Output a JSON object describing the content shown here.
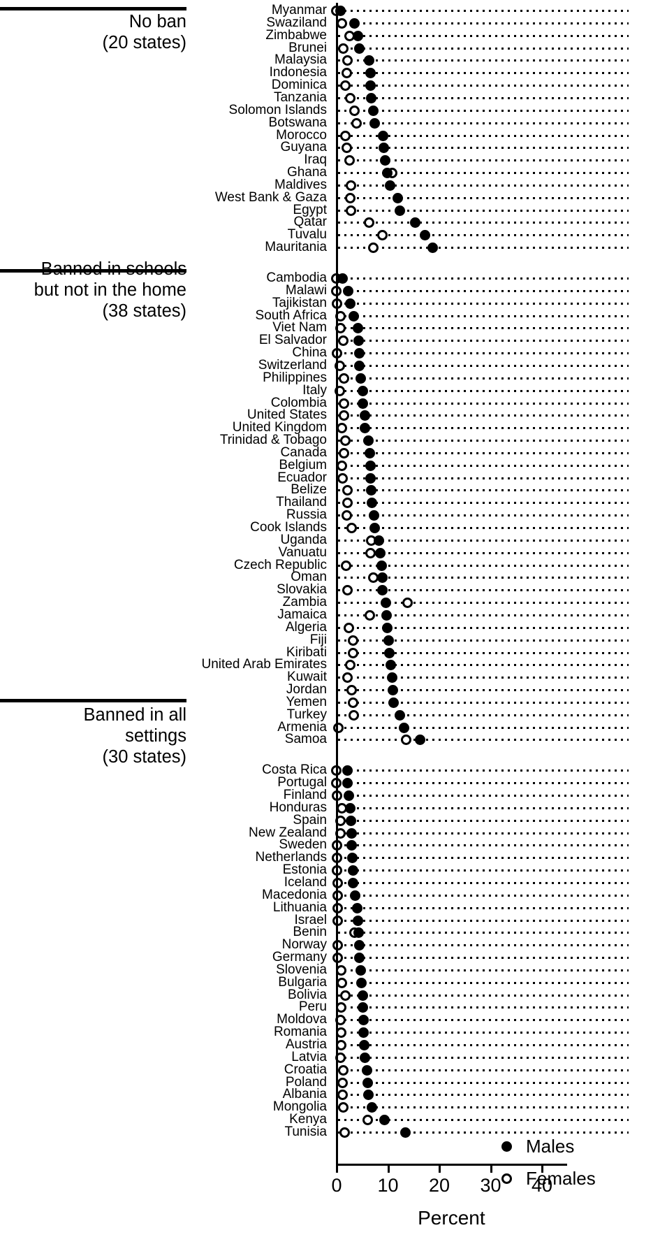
{
  "figure": {
    "xlabel": "Percent",
    "legend": [
      {
        "marker": "filled-circle",
        "label": "Males"
      },
      {
        "marker": "open-circle",
        "label": "Females"
      }
    ]
  },
  "chart_data": {
    "type": "scatter",
    "title": "",
    "xlabel": "Percent",
    "ylabel": "",
    "xlim": [
      0,
      45
    ],
    "xticks": [
      0,
      10,
      20,
      30,
      40
    ],
    "xticklabels": [
      "0",
      "10",
      "20",
      "30",
      "40"
    ],
    "grid": "dotted horizontal leader lines per row",
    "legend_position": "bottom-right",
    "series": [
      {
        "name": "Males",
        "marker": "filled-circle"
      },
      {
        "name": "Females",
        "marker": "open-circle"
      }
    ],
    "groups": [
      {
        "header": "No ban\n(20 states)",
        "header_line1": "No ban",
        "header_line2": "(20 states)",
        "states": 20,
        "rows": [
          {
            "label": "Myanmar",
            "males": 0.9,
            "females": 0.1
          },
          {
            "label": "Swaziland",
            "males": 3.6,
            "females": 1.2
          },
          {
            "label": "Zimbabwe",
            "males": 4.3,
            "females": 2.7
          },
          {
            "label": "Brunei",
            "males": 4.5,
            "females": 1.4
          },
          {
            "label": "Malaysia",
            "males": 6.5,
            "females": 2.3
          },
          {
            "label": "Indonesia",
            "males": 6.8,
            "females": 2.1
          },
          {
            "label": "Dominica",
            "males": 6.8,
            "females": 1.9
          },
          {
            "label": "Tanzania",
            "males": 6.9,
            "females": 2.8
          },
          {
            "label": "Solomon Islands",
            "males": 7.3,
            "females": 3.6
          },
          {
            "label": "Botswana",
            "males": 7.5,
            "females": 4.0
          },
          {
            "label": "Morocco",
            "males": 9.2,
            "females": 1.8
          },
          {
            "label": "Guyana",
            "males": 9.3,
            "females": 2.1
          },
          {
            "label": "Iraq",
            "males": 9.6,
            "females": 2.7
          },
          {
            "label": "Ghana",
            "males": 10.0,
            "females": 11.0
          },
          {
            "label": "Maldives",
            "males": 10.5,
            "females": 2.9
          },
          {
            "label": "West Bank & Gaza",
            "males": 12.0,
            "females": 2.8
          },
          {
            "label": "Egypt",
            "males": 12.5,
            "females": 2.9
          },
          {
            "label": "Qatar",
            "males": 15.5,
            "females": 6.4
          },
          {
            "label": "Tuvalu",
            "males": 17.3,
            "females": 9.0
          },
          {
            "label": "Mauritania",
            "males": 18.9,
            "females": 7.3
          }
        ]
      },
      {
        "header": "Banned in schools\nbut not in the home\n(38 states)",
        "header_line1": "Banned in schools",
        "header_line2": "but not in the home",
        "header_line3": "(38 states)",
        "states": 38,
        "rows": [
          {
            "label": "Cambodia",
            "males": 1.3,
            "females": 0.0
          },
          {
            "label": "Malawi",
            "males": 2.4,
            "females": 0.0
          },
          {
            "label": "Tajikistan",
            "males": 2.8,
            "females": 0.2
          },
          {
            "label": "South Africa",
            "males": 3.5,
            "females": 0.9
          },
          {
            "label": "Viet Nam",
            "males": 4.3,
            "females": 0.9
          },
          {
            "label": "El Salvador",
            "males": 4.4,
            "females": 1.4
          },
          {
            "label": "China",
            "males": 4.6,
            "females": 0.2
          },
          {
            "label": "Switzerland",
            "males": 4.6,
            "females": 0.7
          },
          {
            "label": "Philippines",
            "males": 4.8,
            "females": 1.5
          },
          {
            "label": "Italy",
            "males": 5.2,
            "females": 0.7
          },
          {
            "label": "Colombia",
            "males": 5.3,
            "females": 1.5
          },
          {
            "label": "United States",
            "males": 5.6,
            "females": 1.6
          },
          {
            "label": "United Kingdom",
            "males": 5.7,
            "females": 1.1
          },
          {
            "label": "Trinidad & Tobago",
            "males": 6.3,
            "females": 1.8
          },
          {
            "label": "Canada",
            "males": 6.6,
            "females": 1.5
          },
          {
            "label": "Belgium",
            "males": 6.7,
            "females": 1.2
          },
          {
            "label": "Ecuador",
            "males": 6.7,
            "females": 1.3
          },
          {
            "label": "Belize",
            "males": 6.9,
            "females": 2.3
          },
          {
            "label": "Thailand",
            "males": 7.0,
            "females": 2.2
          },
          {
            "label": "Russia",
            "males": 7.4,
            "females": 2.1
          },
          {
            "label": "Cook Islands",
            "males": 7.5,
            "females": 3.0
          },
          {
            "label": "Uganda",
            "males": 8.4,
            "females": 6.9
          },
          {
            "label": "Vanuatu",
            "males": 8.7,
            "females": 6.8
          },
          {
            "label": "Czech Republic",
            "males": 8.9,
            "females": 2.0
          },
          {
            "label": "Oman",
            "males": 9.0,
            "females": 7.3
          },
          {
            "label": "Slovakia",
            "males": 9.1,
            "females": 2.2
          },
          {
            "label": "Zambia",
            "males": 9.7,
            "females": 14.0
          },
          {
            "label": "Jamaica",
            "males": 9.9,
            "females": 6.6
          },
          {
            "label": "Algeria",
            "males": 10.0,
            "females": 2.5
          },
          {
            "label": "Fiji",
            "males": 10.3,
            "females": 3.4
          },
          {
            "label": "Kiribati",
            "males": 10.4,
            "females": 3.3
          },
          {
            "label": "United Arab Emirates",
            "males": 10.7,
            "females": 2.8
          },
          {
            "label": "Kuwait",
            "males": 11.0,
            "females": 2.3
          },
          {
            "label": "Jordan",
            "males": 11.1,
            "females": 3.1
          },
          {
            "label": "Yemen",
            "males": 11.2,
            "females": 3.4
          },
          {
            "label": "Turkey",
            "males": 12.4,
            "females": 3.5
          },
          {
            "label": "Armenia",
            "males": 13.2,
            "females": 0.5
          },
          {
            "label": "Samoa",
            "males": 16.4,
            "females": 13.7
          }
        ]
      },
      {
        "header": "Banned in all\nsettings\n(30 states)",
        "header_line1": "Banned in all",
        "header_line2": "settings",
        "header_line3": "(30 states)",
        "states": 30,
        "rows": [
          {
            "label": "Costa Rica",
            "males": 2.2,
            "females": 0.1
          },
          {
            "label": "Portugal",
            "males": 2.3,
            "females": 0.1
          },
          {
            "label": "Finland",
            "males": 2.5,
            "females": 0.2
          },
          {
            "label": "Honduras",
            "males": 2.8,
            "females": 1.1
          },
          {
            "label": "Spain",
            "males": 2.9,
            "females": 0.9
          },
          {
            "label": "New Zealand",
            "males": 3.0,
            "females": 0.9
          },
          {
            "label": "Sweden",
            "males": 3.1,
            "females": 0.2
          },
          {
            "label": "Netherlands",
            "males": 3.2,
            "females": 0.2
          },
          {
            "label": "Estonia",
            "males": 3.3,
            "females": 0.2
          },
          {
            "label": "Iceland",
            "males": 3.4,
            "females": 0.3
          },
          {
            "label": "Macedonia",
            "males": 3.7,
            "females": 0.3
          },
          {
            "label": "Lithuania",
            "males": 4.1,
            "females": 0.3
          },
          {
            "label": "Israel",
            "males": 4.3,
            "females": 0.4
          },
          {
            "label": "Benin",
            "males": 4.4,
            "females": 3.6
          },
          {
            "label": "Norway",
            "males": 4.5,
            "females": 0.3
          },
          {
            "label": "Germany",
            "males": 4.6,
            "females": 0.4
          },
          {
            "label": "Slovenia",
            "males": 4.8,
            "females": 1.0
          },
          {
            "label": "Bulgaria",
            "males": 4.9,
            "females": 1.1
          },
          {
            "label": "Bolivia",
            "males": 5.2,
            "females": 1.8
          },
          {
            "label": "Peru",
            "males": 5.3,
            "females": 1.0
          },
          {
            "label": "Moldova",
            "males": 5.4,
            "females": 0.9
          },
          {
            "label": "Romania",
            "males": 5.4,
            "females": 1.0
          },
          {
            "label": "Austria",
            "males": 5.5,
            "females": 1.0
          },
          {
            "label": "Latvia",
            "males": 5.6,
            "females": 0.9
          },
          {
            "label": "Croatia",
            "males": 6.0,
            "females": 1.4
          },
          {
            "label": "Poland",
            "males": 6.2,
            "females": 1.3
          },
          {
            "label": "Albania",
            "males": 6.3,
            "females": 1.3
          },
          {
            "label": "Mongolia",
            "males": 7.0,
            "females": 1.4
          },
          {
            "label": "Kenya",
            "males": 9.4,
            "females": 6.2
          },
          {
            "label": "Tunisia",
            "males": 13.5,
            "females": 1.7
          }
        ]
      }
    ]
  }
}
